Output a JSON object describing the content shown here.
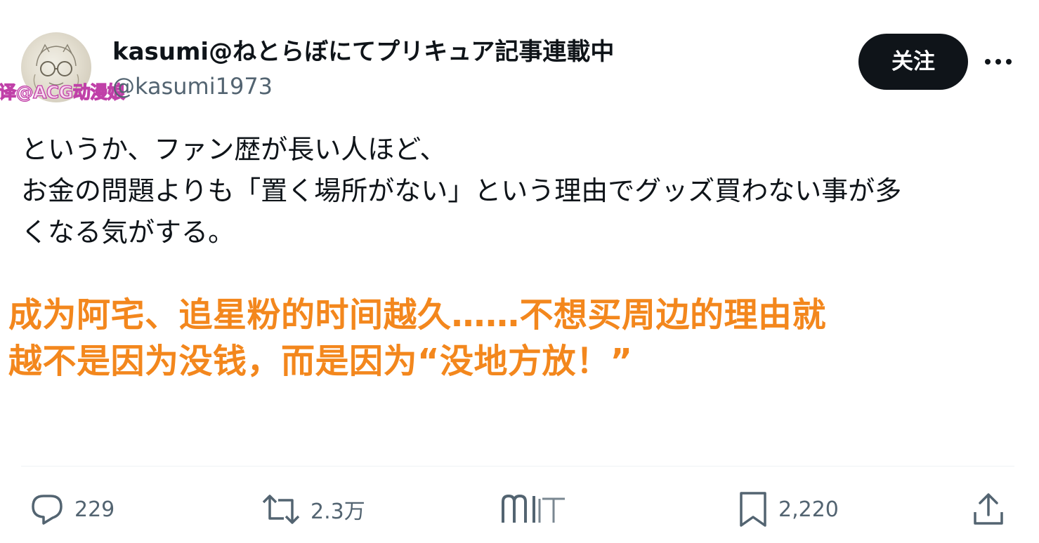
{
  "post": {
    "author": {
      "display_name": "kasumi@ねとらぼにてプリキュア記事連載中",
      "handle": "@kasumi1973"
    },
    "follow_label": "关注",
    "text_lines": [
      "というか、ファン歴が長い人ほど、",
      "お金の問題よりも「置く場所がない」という理由でグッズ買わない事が多",
      "くなる気がする。"
    ],
    "translation_lines": [
      "成为阿宅、追星粉的时间越久……不想买周边的理由就",
      "越不是因为没钱，而是因为“没地方放！”"
    ],
    "watermark": "译@ACG动漫娘",
    "actions": {
      "replies": "229",
      "reposts": "2.3万",
      "likes": "",
      "bookmarks": "2,220"
    }
  },
  "colors": {
    "translation": "#f3871d",
    "follow_button_bg": "#0f1419",
    "secondary_text": "#536471",
    "watermark": "#c040a8"
  },
  "icons": [
    "reply-icon",
    "repost-icon",
    "like-icon",
    "bookmark-icon",
    "share-icon",
    "more-icon"
  ]
}
